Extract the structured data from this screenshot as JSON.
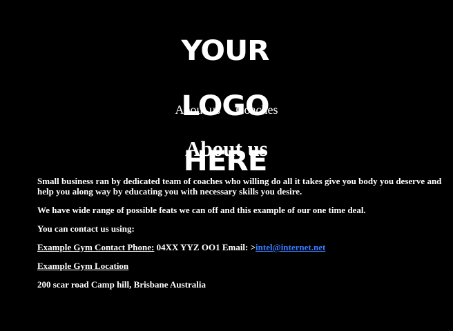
{
  "logo": {
    "lines": [
      "YOUR",
      "LOGO",
      "HERE"
    ]
  },
  "nav": {
    "about_label": "About us",
    "coaches_label": "Coaches"
  },
  "main": {
    "title": "About us",
    "paragraph1": "Small business ran by dedicated team of coaches who willing do all it takes give you body you deserve and help you along way by educating you with necessary skills you desire.",
    "paragraph2": "We have wide range of possible feats we can off and this example of our one time deal.",
    "contact_intro": "You can contact us using:",
    "phone_label": "Example Gym Contact Phone:",
    "phone_value": " 04XX YYZ OO1 Email: >",
    "email": "intel@internet.net",
    "location_label": "Example Gym Location",
    "address": "200 scar road Camp hill, Brisbane Australia"
  },
  "colors": {
    "background": "#000000",
    "text": "#ffffff",
    "link": "#3a7bff"
  }
}
